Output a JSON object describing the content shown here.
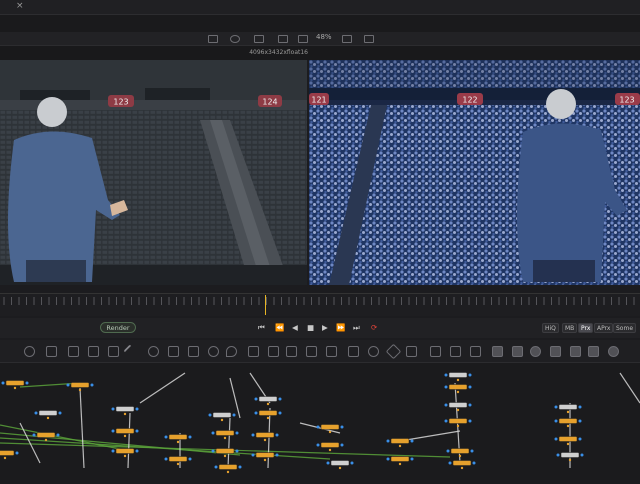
{
  "window": {
    "close_glyph": "×"
  },
  "viewer": {
    "zoom": "48%",
    "resolution": "4096x3432xfloat16",
    "left_view": {
      "section_numbers": [
        "123",
        "124"
      ],
      "description_icon": "speaker-on-empty-stadium"
    },
    "right_view": {
      "section_numbers": [
        "121",
        "122",
        "123"
      ],
      "description_icon": "speaker-on-full-stadium"
    }
  },
  "transport": {
    "render_label": "Render",
    "controls": [
      {
        "name": "go-to-start",
        "glyph": "⏮"
      },
      {
        "name": "step-back",
        "glyph": "⏪"
      },
      {
        "name": "play-reverse",
        "glyph": "◀"
      },
      {
        "name": "stop",
        "glyph": "■"
      },
      {
        "name": "play",
        "glyph": "▶"
      },
      {
        "name": "step-forward",
        "glyph": "⏩"
      },
      {
        "name": "go-to-end",
        "glyph": "⏭"
      },
      {
        "name": "loop",
        "glyph": "⟳"
      }
    ],
    "quality_buttons": [
      "HiQ",
      "MB",
      "Prx",
      "APrx",
      "Some"
    ],
    "active_quality": "Prx"
  },
  "timeline": {
    "playhead_fraction": 0.414
  },
  "colors": {
    "accent_yellow": "#e7b526",
    "loop_red": "#e0443a",
    "node_orange": "#e6a12d",
    "link_green": "#5aa23a",
    "link_white": "#d8d8d8",
    "port_blue": "#3a8fe8"
  }
}
